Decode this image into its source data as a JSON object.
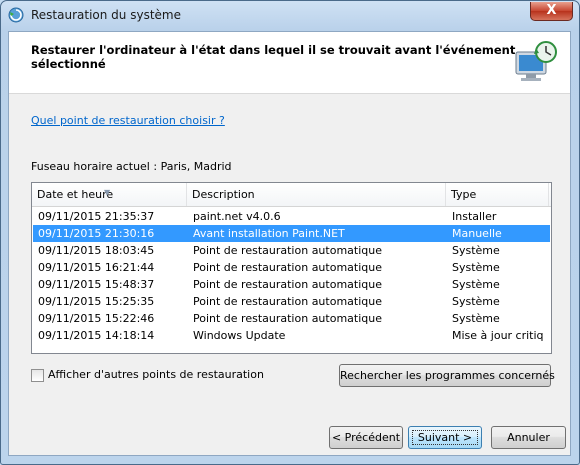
{
  "window": {
    "title": "Restauration du système",
    "close_label": "X"
  },
  "header": {
    "title": "Restaurer l'ordinateur à l'état dans lequel il se trouvait avant l'événement sélectionné"
  },
  "help_link": "Quel point de restauration choisir ?",
  "timezone": "Fuseau horaire actuel : Paris, Madrid",
  "list": {
    "columns": [
      "Date et heure",
      "Description",
      "Type"
    ],
    "rows": [
      {
        "date": "09/11/2015 21:35:37",
        "description": "paint.net v4.0.6",
        "type": "Installer",
        "selected": false
      },
      {
        "date": "09/11/2015 21:30:16",
        "description": "Avant installation Paint.NET",
        "type": "Manuelle",
        "selected": true
      },
      {
        "date": "09/11/2015 18:03:45",
        "description": "Point de restauration automatique",
        "type": "Système",
        "selected": false
      },
      {
        "date": "09/11/2015 16:21:44",
        "description": "Point de restauration automatique",
        "type": "Système",
        "selected": false
      },
      {
        "date": "09/11/2015 15:48:37",
        "description": "Point de restauration automatique",
        "type": "Système",
        "selected": false
      },
      {
        "date": "09/11/2015 15:25:35",
        "description": "Point de restauration automatique",
        "type": "Système",
        "selected": false
      },
      {
        "date": "09/11/2015 15:22:46",
        "description": "Point de restauration automatique",
        "type": "Système",
        "selected": false
      },
      {
        "date": "09/11/2015 14:18:14",
        "description": "Windows Update",
        "type": "Mise à jour critiq...",
        "selected": false
      }
    ]
  },
  "checkbox": {
    "label": "Afficher d'autres points de restauration",
    "checked": false
  },
  "buttons": {
    "scan": "Rechercher les programmes concernés",
    "back": "< Précédent",
    "next": "Suivant >",
    "cancel": "Annuler"
  },
  "colors": {
    "selection": "#3399ff",
    "link": "#0066cc"
  }
}
